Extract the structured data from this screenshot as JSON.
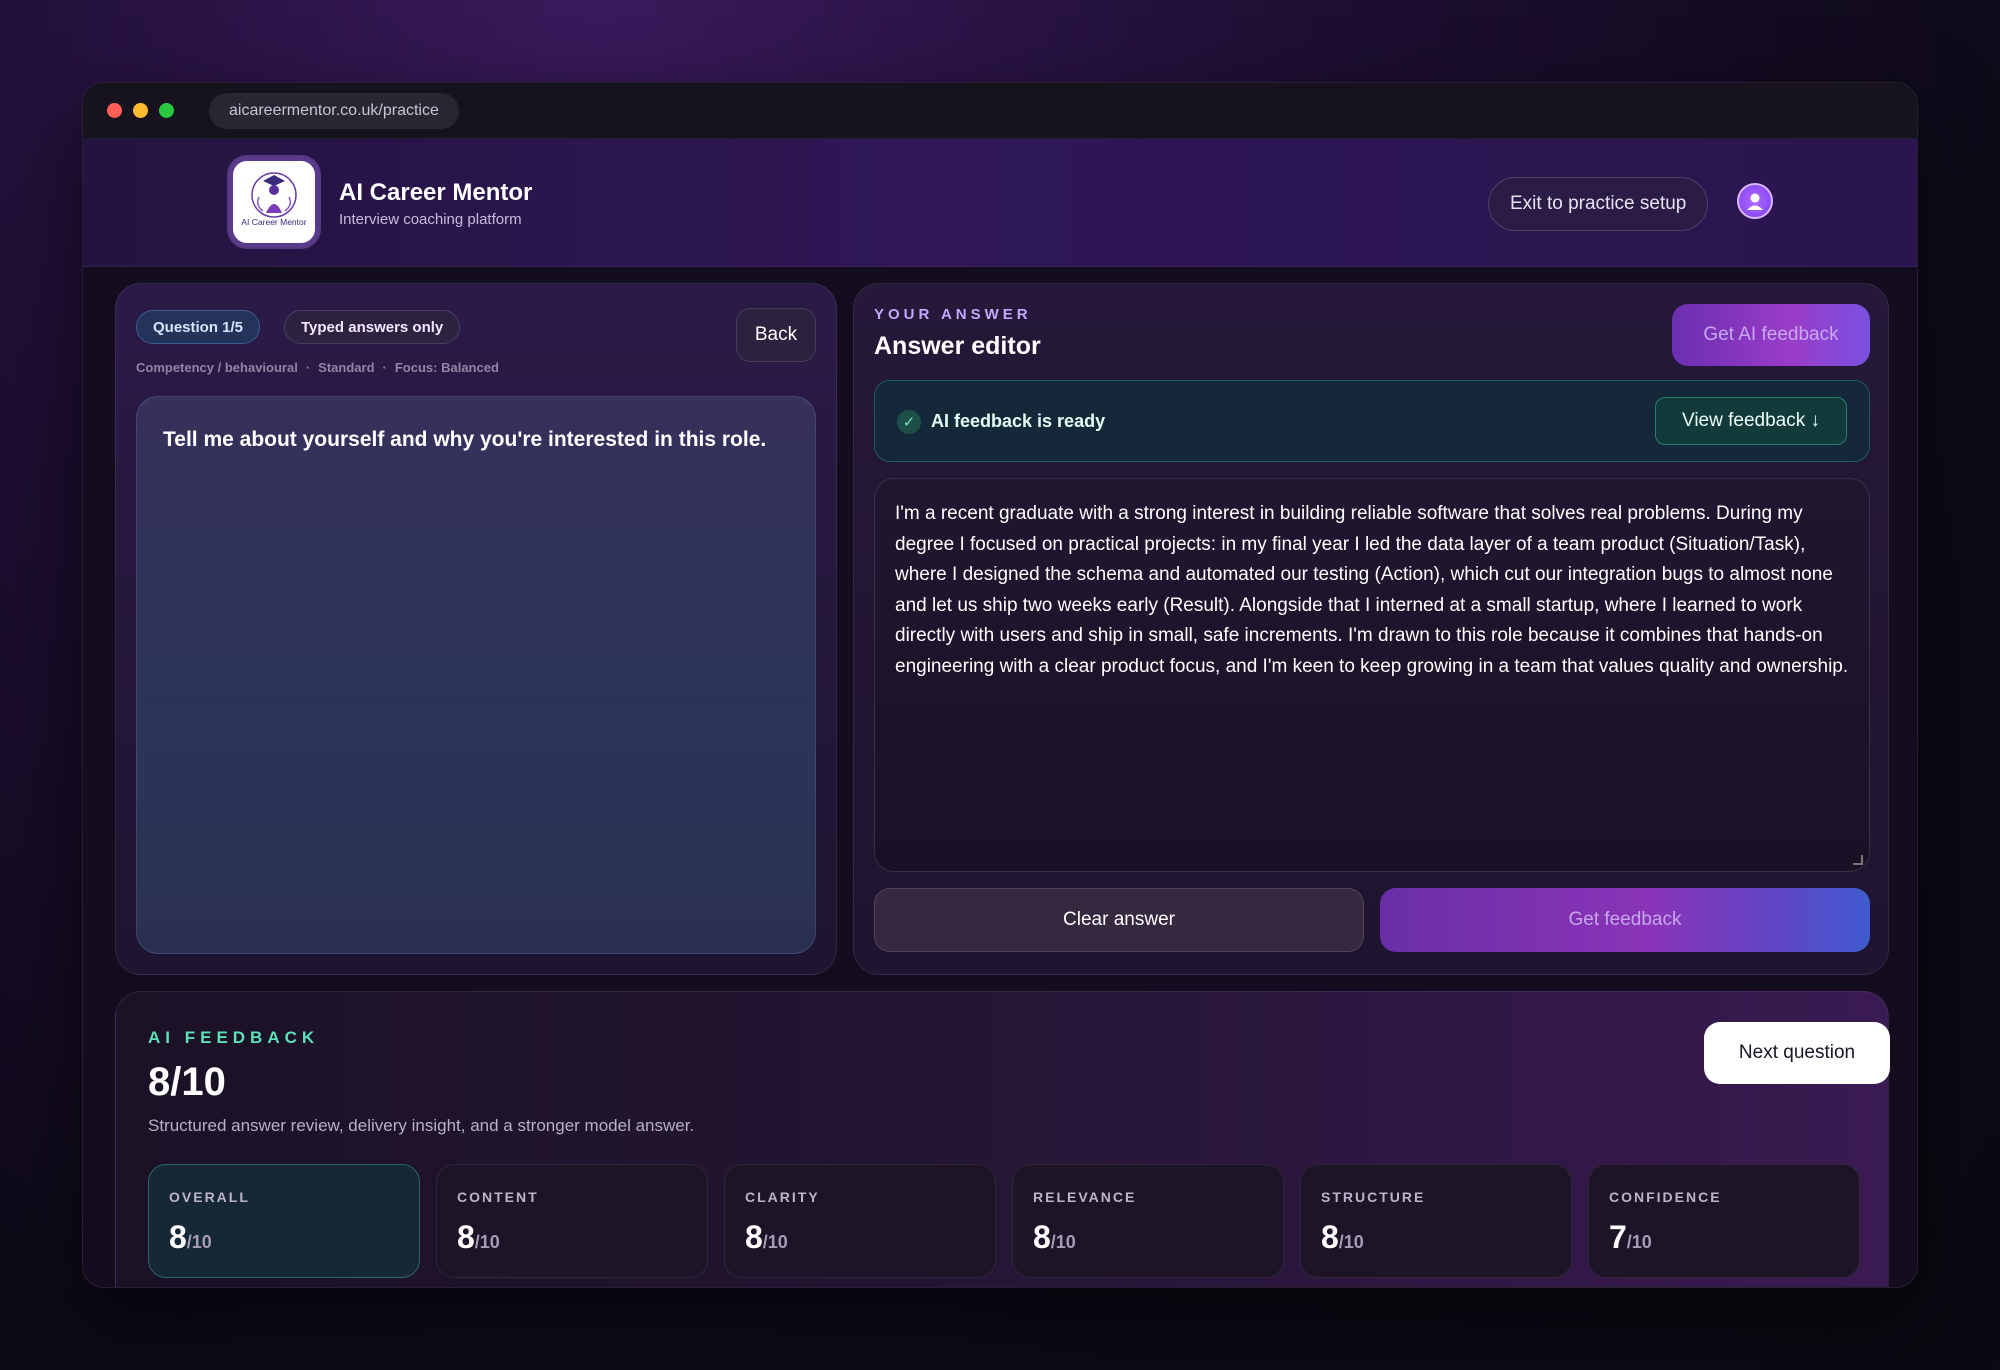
{
  "browser": {
    "url": "aicareermentor.co.uk/practice"
  },
  "header": {
    "brand_title": "AI Career Mentor",
    "brand_subtitle": "Interview coaching platform",
    "logo_text": "AI Career Mentor",
    "exit_label": "Exit to practice setup"
  },
  "question_panel": {
    "question_pill": "Question 1/5",
    "mode_pill": "Typed answers only",
    "back_label": "Back",
    "meta": [
      "Competency / behavioural",
      "Standard",
      "Focus: Balanced"
    ],
    "meta_separator": "·",
    "question": "Tell me about yourself and why you're interested in this role."
  },
  "answer_panel": {
    "eyebrow": "YOUR ANSWER",
    "title": "Answer editor",
    "ai_feedback_label": "Get AI feedback",
    "ready_text": "AI feedback is ready",
    "check_glyph": "✓",
    "view_feedback_label": "View feedback ↓",
    "answer": "I'm a recent graduate with a strong interest in building reliable software that solves real problems. During my degree I focused on practical projects: in my final year I led the data layer of a team product (Situation/Task), where I designed the schema and automated our testing (Action), which cut our integration bugs to almost none and let us ship two weeks early (Result). Alongside that I interned at a small startup, where I learned to work directly with users and ship in small, safe increments. I'm drawn to this role because it combines that hands-on engineering with a clear product focus, and I'm keen to keep growing in a team that values quality and ownership.",
    "clear_label": "Clear answer",
    "get_feedback_label": "Get feedback"
  },
  "feedback": {
    "eyebrow": "AI FEEDBACK",
    "score": "8/10",
    "description": "Structured answer review, delivery insight, and a stronger model answer.",
    "next_label": "Next question",
    "denominator": "/10",
    "scores": [
      {
        "label": "OVERALL",
        "value": "8"
      },
      {
        "label": "CONTENT",
        "value": "8"
      },
      {
        "label": "CLARITY",
        "value": "8"
      },
      {
        "label": "RELEVANCE",
        "value": "8"
      },
      {
        "label": "STRUCTURE",
        "value": "8"
      },
      {
        "label": "CONFIDENCE",
        "value": "7"
      }
    ]
  },
  "colors": {
    "accent_purple": "#8a34b8",
    "success_teal": "#5ce0b8",
    "question_pill_blue": "#24335a"
  }
}
